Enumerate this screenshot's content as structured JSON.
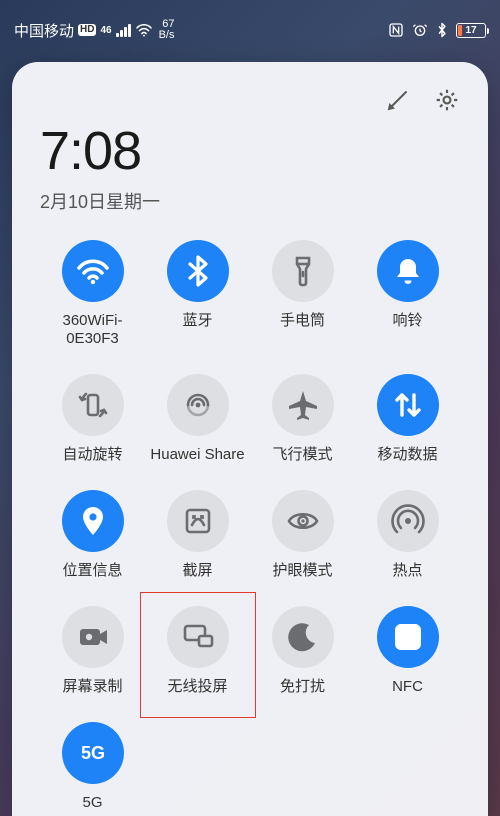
{
  "status": {
    "carrier": "中国移动",
    "hd_label": "HD",
    "net_gen": "46",
    "speed_value": "67",
    "speed_unit": "B/s",
    "battery_percent": 17,
    "battery_text": "17"
  },
  "panel": {
    "time": "7:08",
    "date": "2月10日星期一"
  },
  "tiles": [
    {
      "id": "wifi",
      "icon": "wifi-icon",
      "label": "360WiFi-\n0E30F3",
      "on": true
    },
    {
      "id": "bluetooth",
      "icon": "bluetooth-icon",
      "label": "蓝牙",
      "on": true
    },
    {
      "id": "flashlight",
      "icon": "flashlight-icon",
      "label": "手电筒",
      "on": false
    },
    {
      "id": "ringer",
      "icon": "bell-icon",
      "label": "响铃",
      "on": true
    },
    {
      "id": "autorotate",
      "icon": "rotate-icon",
      "label": "自动旋转",
      "on": false
    },
    {
      "id": "huaweishare",
      "icon": "share-icon",
      "label": "Huawei Share",
      "on": false
    },
    {
      "id": "airplane",
      "icon": "airplane-icon",
      "label": "飞行模式",
      "on": false
    },
    {
      "id": "mobiledata",
      "icon": "data-icon",
      "label": "移动数据",
      "on": true
    },
    {
      "id": "location",
      "icon": "location-icon",
      "label": "位置信息",
      "on": true
    },
    {
      "id": "screenshot",
      "icon": "screenshot-icon",
      "label": "截屏",
      "on": false
    },
    {
      "id": "eyecomfort",
      "icon": "eye-icon",
      "label": "护眼模式",
      "on": false
    },
    {
      "id": "hotspot",
      "icon": "hotspot-icon",
      "label": "热点",
      "on": false
    },
    {
      "id": "screenrecord",
      "icon": "record-icon",
      "label": "屏幕录制",
      "on": false
    },
    {
      "id": "cast",
      "icon": "cast-icon",
      "label": "无线投屏",
      "on": false,
      "highlighted": true
    },
    {
      "id": "dnd",
      "icon": "moon-icon",
      "label": "免打扰",
      "on": false
    },
    {
      "id": "nfc",
      "icon": "nfc-icon",
      "label": "NFC",
      "on": true
    },
    {
      "id": "5g",
      "icon": "5g-icon",
      "label": "5G",
      "on": true
    }
  ]
}
